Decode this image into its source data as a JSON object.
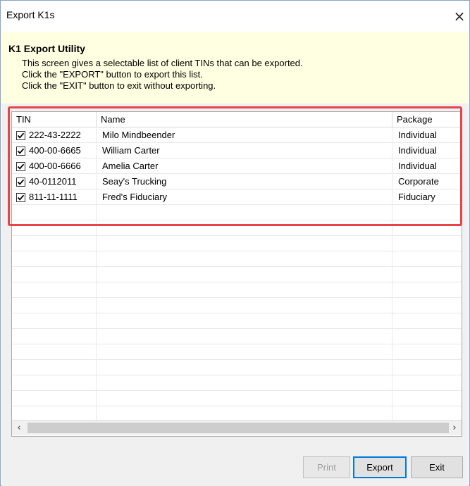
{
  "window": {
    "title": "Export K1s",
    "close_glyph": "×"
  },
  "header": {
    "title": "K1 Export Utility",
    "lines": [
      "This screen gives a selectable list of client TINs that can be exported.",
      "Click the \"EXPORT\" button to export this list.",
      "Click the \"EXIT\" button to exit without exporting."
    ]
  },
  "table": {
    "columns": [
      "TIN",
      "Name",
      "Package"
    ],
    "rows": [
      {
        "checked": true,
        "tin": "222-43-2222",
        "name": "Milo Mindbeender",
        "package": "Individual"
      },
      {
        "checked": true,
        "tin": "400-00-6665",
        "name": "William Carter",
        "package": "Individual"
      },
      {
        "checked": true,
        "tin": "400-00-6666",
        "name": "Amelia Carter",
        "package": "Individual"
      },
      {
        "checked": true,
        "tin": "40-0112011",
        "name": "Seay's Trucking",
        "package": "Corporate"
      },
      {
        "checked": true,
        "tin": "811-11-1111",
        "name": "Fred's Fiduciary",
        "package": "Fiduciary"
      }
    ]
  },
  "scrollbar": {
    "left_glyph": "‹",
    "right_glyph": "›"
  },
  "buttons": {
    "print": "Print",
    "export": "Export",
    "exit": "Exit"
  },
  "colors": {
    "highlight": "#e8434b",
    "header_bg": "#ffffe1",
    "focus_border": "#0078d7"
  }
}
